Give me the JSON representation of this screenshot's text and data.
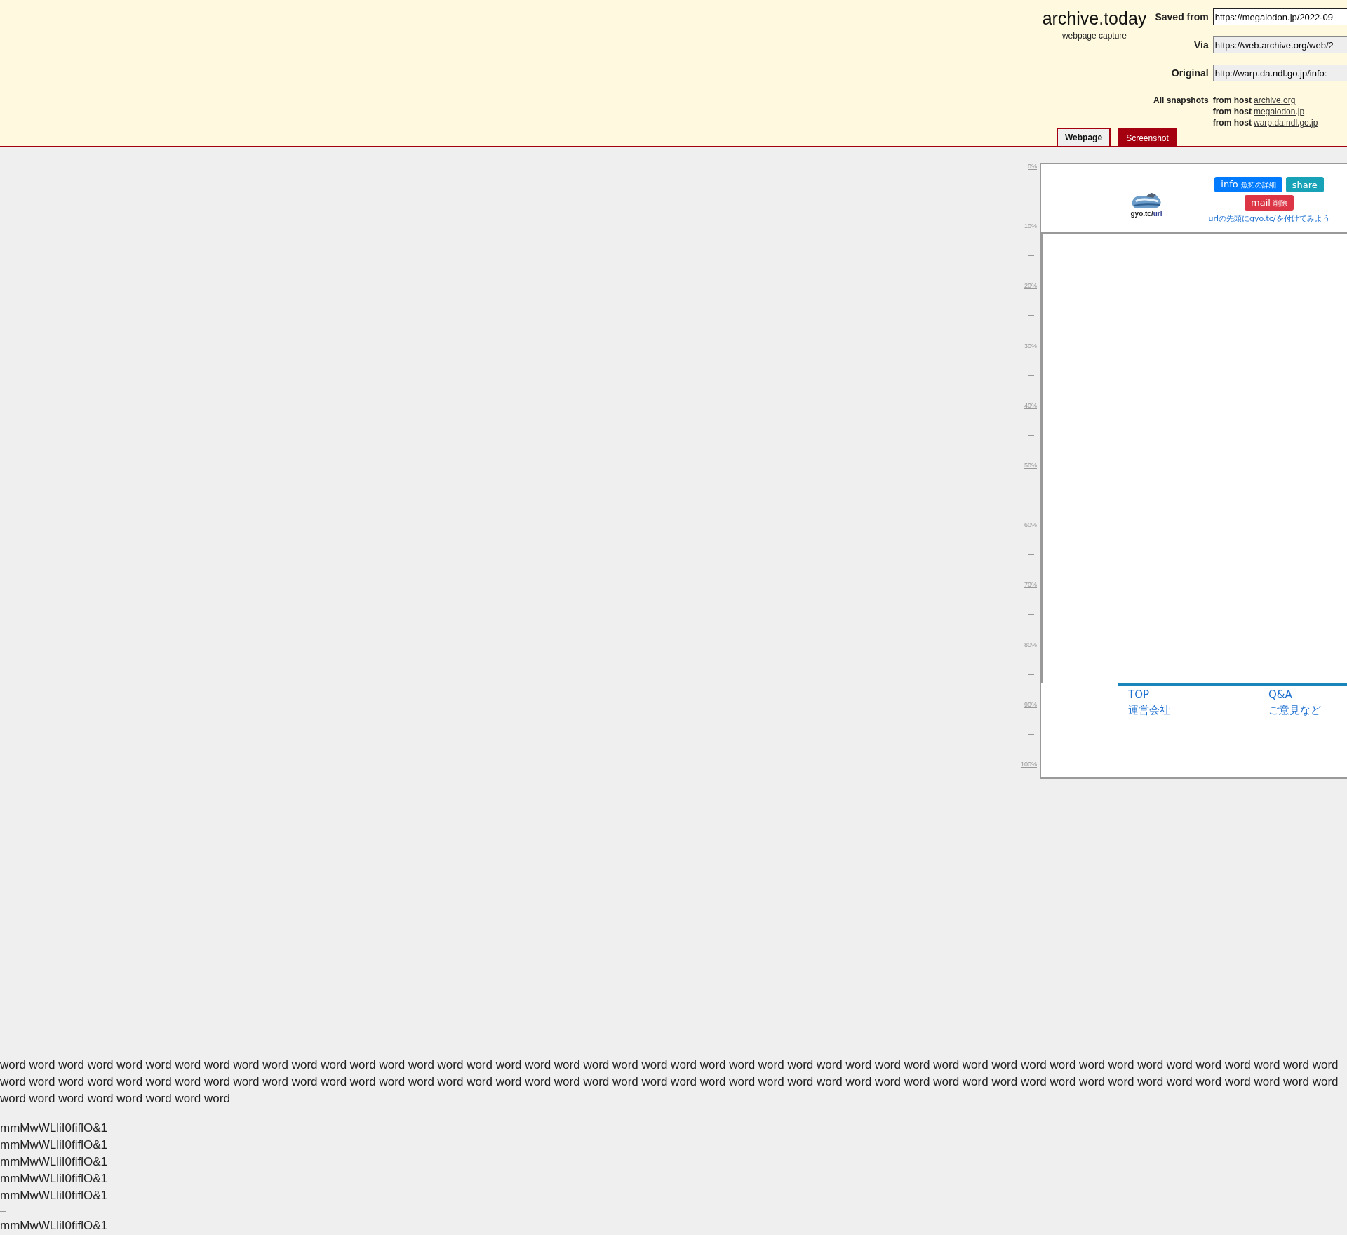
{
  "header": {
    "title": "archive.today",
    "subtitle": "webpage capture",
    "fields": [
      {
        "label": "Saved from",
        "value": "https://megalodon.jp/2022-09",
        "readonly": false
      },
      {
        "label": "Via",
        "value": "https://web.archive.org/web/2",
        "readonly": true
      },
      {
        "label": "Original",
        "value": "http://warp.da.ndl.go.jp/info:",
        "readonly": true
      }
    ],
    "snapshots": {
      "label": "All snapshots",
      "items": [
        {
          "prefix": "from host",
          "link": "archive.org"
        },
        {
          "prefix": "from host",
          "link": "megalodon.jp"
        },
        {
          "prefix": "from host",
          "link": "warp.da.ndl.go.jp"
        }
      ]
    }
  },
  "tabs": [
    {
      "label": "Webpage",
      "selected": true
    },
    {
      "label": "Screenshot",
      "selected": false
    }
  ],
  "scale": [
    "0%",
    "10%",
    "20%",
    "30%",
    "40%",
    "50%",
    "60%",
    "70%",
    "80%",
    "90%",
    "100%"
  ],
  "preview": {
    "logo_text": "gyo.tc/",
    "logo_accent": "url",
    "buttons": [
      {
        "label": "info",
        "sub": "魚拓の詳細",
        "color": "#007bff"
      },
      {
        "label": "share",
        "color": "#17a2b8"
      },
      {
        "label": "mail",
        "sub": "削除",
        "color": "#dc3545"
      }
    ],
    "tagline": "urlの先頭にgyo.tc/を付けてみよう",
    "footer_links": [
      "TOP",
      "Q&A",
      "運営会社",
      "ご意見など"
    ]
  },
  "body": {
    "paragraph": "word word word word word word word word word word word word word word word word word word word word word word word word word word word word word word word word word word word word word word word word word word word word word word word word word word word word word word word word word word word word word word word word word word word word word word word word word word word word word word word word word word word word word word word word word word word word word word word word word word word word",
    "lines": [
      "mmMwWLliI0fiflO&1",
      "mmMwWLliI0fiflO&1",
      "mmMwWLliI0fiflO&1",
      "mmMwWLliI0fiflO&1",
      "mmMwWLliI0fiflO&1"
    ],
    "after_rule": [
      "mmMwWLliI0fiflO&1"
    ]
  }
}
